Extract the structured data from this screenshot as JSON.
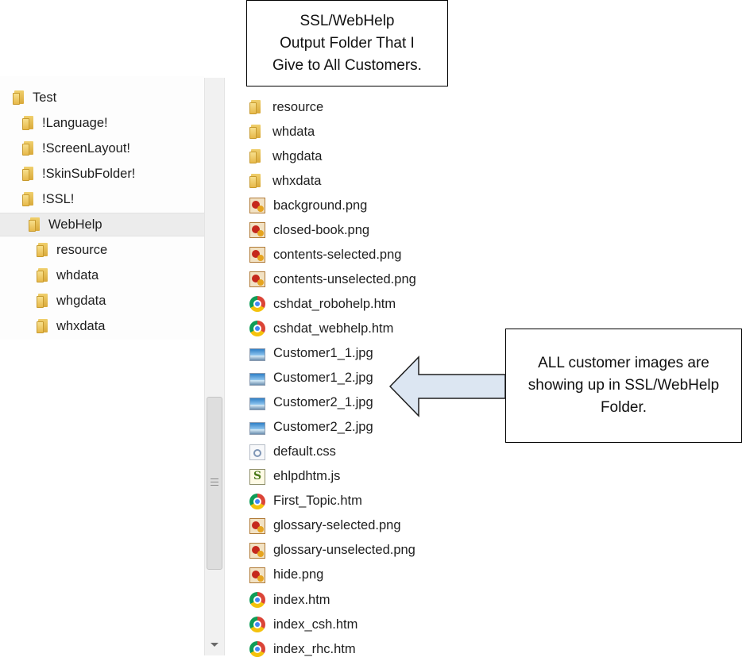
{
  "tree": {
    "items": [
      {
        "label": "Test",
        "level": 0
      },
      {
        "label": "!Language!",
        "level": 1
      },
      {
        "label": "!ScreenLayout!",
        "level": 1
      },
      {
        "label": "!SkinSubFolder!",
        "level": 1
      },
      {
        "label": "!SSL!",
        "level": 1
      },
      {
        "label": "WebHelp",
        "level": 2,
        "selected": true
      },
      {
        "label": "resource",
        "level": 3
      },
      {
        "label": "whdata",
        "level": 3
      },
      {
        "label": "whgdata",
        "level": 3
      },
      {
        "label": "whxdata",
        "level": 3
      }
    ]
  },
  "files": [
    {
      "name": "resource",
      "icon": "folder-icon"
    },
    {
      "name": "whdata",
      "icon": "folder-icon"
    },
    {
      "name": "whgdata",
      "icon": "folder-icon"
    },
    {
      "name": "whxdata",
      "icon": "folder-icon"
    },
    {
      "name": "background.png",
      "icon": "png-image-icon"
    },
    {
      "name": "closed-book.png",
      "icon": "png-image-icon"
    },
    {
      "name": "contents-selected.png",
      "icon": "png-image-icon"
    },
    {
      "name": "contents-unselected.png",
      "icon": "png-image-icon"
    },
    {
      "name": "cshdat_robohelp.htm",
      "icon": "chrome-icon"
    },
    {
      "name": "cshdat_webhelp.htm",
      "icon": "chrome-icon"
    },
    {
      "name": "Customer1_1.jpg",
      "icon": "jpg-image-icon"
    },
    {
      "name": "Customer1_2.jpg",
      "icon": "jpg-image-icon"
    },
    {
      "name": "Customer2_1.jpg",
      "icon": "jpg-image-icon"
    },
    {
      "name": "Customer2_2.jpg",
      "icon": "jpg-image-icon"
    },
    {
      "name": "default.css",
      "icon": "css-file-icon"
    },
    {
      "name": "ehlpdhtm.js",
      "icon": "js-file-icon"
    },
    {
      "name": "First_Topic.htm",
      "icon": "chrome-icon"
    },
    {
      "name": "glossary-selected.png",
      "icon": "png-image-icon"
    },
    {
      "name": "glossary-unselected.png",
      "icon": "png-image-icon"
    },
    {
      "name": "hide.png",
      "icon": "png-image-icon"
    },
    {
      "name": "index.htm",
      "icon": "chrome-icon"
    },
    {
      "name": "index_csh.htm",
      "icon": "chrome-icon"
    },
    {
      "name": "index_rhc.htm",
      "icon": "chrome-icon"
    }
  ],
  "callouts": {
    "top": "SSL/WebHelp\nOutput Folder That I\nGive to All Customers.",
    "right": "ALL customer images are\nshowing up in SSL/WebHelp\nFolder."
  },
  "colors": {
    "selection": "#ececec",
    "folder": "#e7b84a",
    "arrow_fill": "#dce6f2",
    "arrow_stroke": "#1f1f1f"
  }
}
